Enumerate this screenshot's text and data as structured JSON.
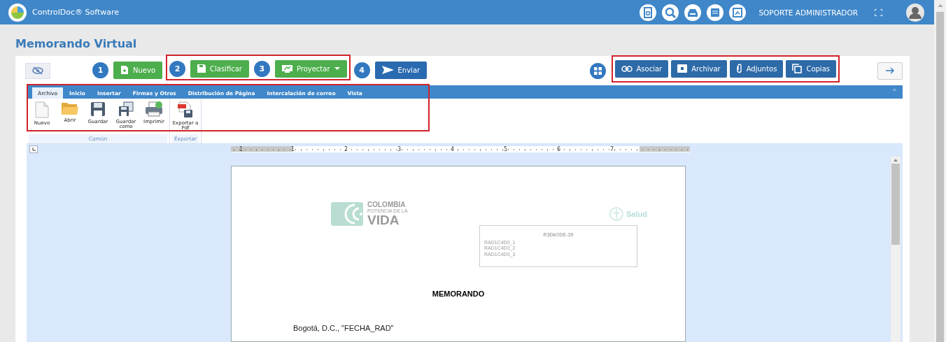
{
  "header": {
    "app_name": "ControlDoc® Software",
    "user": "SOPORTE ADMINISTRADOR"
  },
  "page_title": "Memorando Virtual",
  "toolbar": {
    "left_groups": [
      {
        "highlighted": false,
        "steps": [
          {
            "number": "1",
            "label": "Nuevo",
            "kind": "success",
            "dropdown": false
          }
        ]
      },
      {
        "highlighted": true,
        "steps": [
          {
            "number": "2",
            "label": "Clasificar",
            "kind": "success",
            "dropdown": false
          },
          {
            "number": "3",
            "label": "Proyectar",
            "kind": "success",
            "dropdown": true
          }
        ]
      },
      {
        "highlighted": false,
        "steps": [
          {
            "number": "4",
            "label": "Enviar",
            "kind": "primary",
            "dropdown": false
          }
        ]
      }
    ],
    "right_highlighted": true,
    "right_buttons": [
      {
        "label": "Asociar"
      },
      {
        "label": "Archivar"
      },
      {
        "label": "Adjuntos"
      },
      {
        "label": "Copias"
      }
    ]
  },
  "ribbon": {
    "highlighted": true,
    "tabs": [
      {
        "label": "Archivo",
        "selected": true
      },
      {
        "label": "Inicio",
        "selected": false
      },
      {
        "label": "Insertar",
        "selected": false
      },
      {
        "label": "Firmas y Otros",
        "selected": false
      },
      {
        "label": "Distribución de Página",
        "selected": false
      },
      {
        "label": "Intercalación de correo",
        "selected": false
      },
      {
        "label": "Vista",
        "selected": false
      }
    ],
    "groups": [
      {
        "label": "Común",
        "commands": [
          {
            "label": "Nuevo"
          },
          {
            "label": "Abrir"
          },
          {
            "label": "Guardar"
          },
          {
            "label": "Guardar como"
          },
          {
            "label": "Imprimir"
          }
        ]
      },
      {
        "label": "Exportar",
        "commands": [
          {
            "label": "Exportar a Pdf"
          }
        ]
      }
    ]
  },
  "ruler": {
    "marks": [
      "1",
      "1",
      "2",
      "3",
      "4",
      "5",
      "6",
      "7"
    ]
  },
  "document": {
    "logo_lines": [
      "COLOMBIA",
      "POTENCIA DE LA",
      "VIDA"
    ],
    "ministry": "Salud",
    "barcode_label": "R3DkODE-39",
    "radicado_lines": [
      "RAD1C4D0_1",
      "RAD1C4D0_2",
      "RAD1C4D0_3"
    ],
    "heading": "MEMORANDO",
    "date_line": "Bogotá, D.C., \"FECHA_RAD\""
  }
}
